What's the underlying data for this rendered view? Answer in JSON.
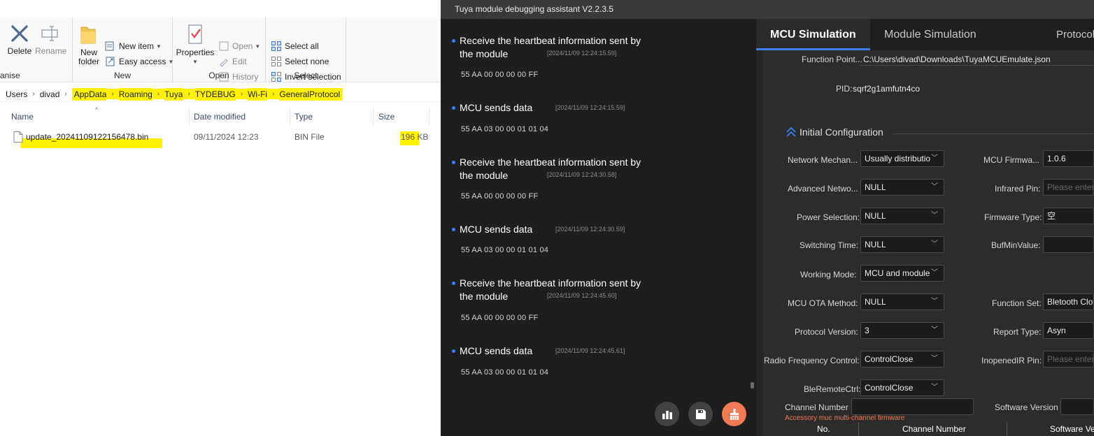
{
  "explorer": {
    "ribbon": {
      "groups": {
        "organise": "anise",
        "new": "New",
        "open": "Open",
        "select": "Select"
      },
      "delete": "Delete",
      "rename": "Rename",
      "new_folder": "New folder",
      "new_item": "New item",
      "easy_access": "Easy access",
      "properties": "Properties",
      "open": "Open",
      "edit": "Edit",
      "history": "History",
      "select_all": "Select all",
      "select_none": "Select none",
      "invert_selection": "Invert selection"
    },
    "breadcrumb": [
      "Users",
      "divad",
      "AppData",
      "Roaming",
      "Tuya",
      "TYDEBUG",
      "Wi-Fi",
      "GeneralProtocol"
    ],
    "columns": {
      "name": "Name",
      "date_modified": "Date modified",
      "type": "Type",
      "size": "Size"
    },
    "files": [
      {
        "name": "update_20241109122156478.bin",
        "date_modified": "09/11/2024 12:23",
        "type": "BIN File",
        "size": "196 KB"
      }
    ],
    "highlight_color": "#fff200"
  },
  "tuya": {
    "window_title": "Tuya module debugging assistant V2.2.3.5",
    "accent_color": "#3f7ff0",
    "log": [
      {
        "title": "Receive the heartbeat information sent by the module",
        "time": "[2024/11/09 12:24:15.59]",
        "hex": "55 AA 00 00 00 00 FF"
      },
      {
        "title": "MCU sends data",
        "time": "[2024/11/09 12:24:15.59]",
        "hex": "55 AA 03 00 00 01 01 04"
      },
      {
        "title": "Receive the heartbeat information sent by the module",
        "time": "[2024/11/09 12:24:30.58]",
        "hex": "55 AA 00 00 00 00 FF"
      },
      {
        "title": "MCU sends data",
        "time": "[2024/11/09 12:24:30.59]",
        "hex": "55 AA 03 00 00 01 01 04"
      },
      {
        "title": "Receive the heartbeat information sent by the module",
        "time": "[2024/11/09 12:24:45.60]",
        "hex": "55 AA 00 00 00 00 FF"
      },
      {
        "title": "MCU sends data",
        "time": "[2024/11/09 12:24:45.61]",
        "hex": "55 AA 03 00 00 01 01 04"
      }
    ],
    "log_buttons": [
      "bar-chart-icon",
      "save-icon",
      "clear-broom-icon"
    ],
    "tabs": [
      "MCU Simulation",
      "Module Simulation",
      "Protocol"
    ],
    "function_point": {
      "label": "Function Point...",
      "value": "C:\\Users\\divad\\Downloads\\TuyaMCUEmulate.json"
    },
    "pid": {
      "label": "PID:",
      "value": "sqrf2g1amfutn4co"
    },
    "initial_configuration": "Initial Configuration",
    "fields_left": [
      {
        "label": "Network Mechan...",
        "value": "Usually distributio"
      },
      {
        "label": "Advanced Netwo...",
        "value": "NULL"
      },
      {
        "label": "Power Selection:",
        "value": "NULL"
      },
      {
        "label": "Switching Time:",
        "value": "NULL"
      },
      {
        "label": "Working Mode:",
        "value": "MCU and module"
      },
      {
        "label": "MCU OTA Method:",
        "value": "NULL"
      },
      {
        "label": "Protocol Version:",
        "value": "3"
      },
      {
        "label": "Radio Frequency Control:",
        "value": "ControlClose"
      },
      {
        "label": "BleRemoteCtrl:",
        "value": "ControlClose"
      }
    ],
    "fields_right": [
      {
        "label": "MCU Firmwa...",
        "value": "1.0.6",
        "placeholder": ""
      },
      {
        "label": "Infrared Pin:",
        "value": "",
        "placeholder": "Please enter t"
      },
      {
        "label": "Firmware Type:",
        "value": "空",
        "placeholder": ""
      },
      {
        "label": "BufMinValue:",
        "value": "",
        "placeholder": ""
      },
      {
        "label": "Function Set:",
        "value": "Bletooth Clos",
        "placeholder": ""
      },
      {
        "label": "Report Type:",
        "value": "Asyn",
        "placeholder": ""
      },
      {
        "label": "InopenedIR Pin:",
        "value": "",
        "placeholder": "Please enter t"
      }
    ],
    "accessory_note": "Accessory muc multi-channel firmware",
    "channel_number_label": "Channel Number",
    "software_version_label": "Software Version",
    "table_headers": [
      "No.",
      "Channel Number",
      "Software Ve"
    ]
  }
}
